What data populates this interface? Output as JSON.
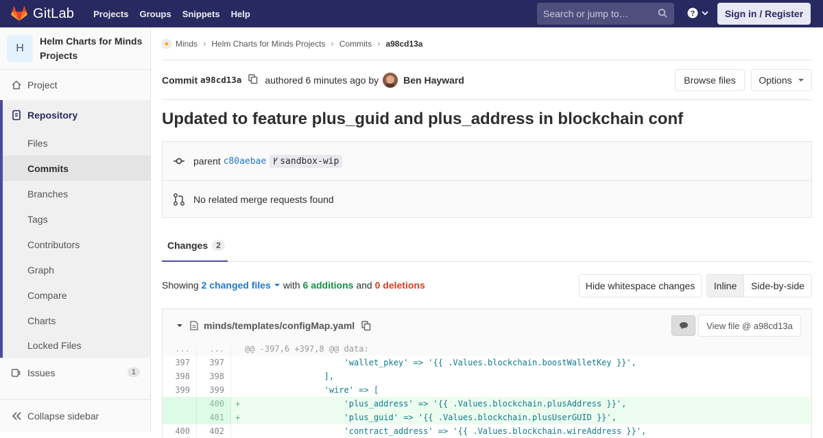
{
  "topbar": {
    "brand": "GitLab",
    "nav": [
      "Projects",
      "Groups",
      "Snippets",
      "Help"
    ],
    "search_placeholder": "Search or jump to…",
    "signin_label": "Sign in / Register",
    "bg_color": "#292961"
  },
  "sidebar": {
    "project_initial": "H",
    "project_name": "Helm Charts for Minds Projects",
    "items": {
      "project": "Project",
      "repository": "Repository",
      "issues": "Issues",
      "issues_count": "1",
      "collapse": "Collapse sidebar"
    },
    "repo_sub": [
      "Files",
      "Commits",
      "Branches",
      "Tags",
      "Contributors",
      "Graph",
      "Compare",
      "Charts",
      "Locked Files"
    ],
    "active_sub": "Commits"
  },
  "breadcrumb": [
    "Minds",
    "Helm Charts for Minds Projects",
    "Commits",
    "a98cd13a"
  ],
  "commit": {
    "label": "Commit",
    "sha": "a98cd13a",
    "authored": "authored 6 minutes ago by",
    "author": "Ben Hayward",
    "browse_label": "Browse files",
    "options_label": "Options",
    "title": "Updated to feature plus_guid and plus_address in blockchain conf",
    "parent_label": "parent",
    "parent_sha": "c80aebae",
    "branch": "sandbox-wip",
    "mr_text": "No related merge requests found"
  },
  "tabs": {
    "changes_label": "Changes",
    "changes_count": "2"
  },
  "summary": {
    "showing": "Showing",
    "changed_files": "2 changed files",
    "with": "with",
    "additions": "6 additions",
    "and": "and",
    "deletions": "0 deletions",
    "hide_ws": "Hide whitespace changes",
    "inline": "Inline",
    "side_by_side": "Side-by-side"
  },
  "file": {
    "path": "minds/templates/configMap.yaml",
    "view_label": "View file @ a98cd13a"
  },
  "diff": {
    "lines": [
      {
        "type": "meta",
        "old": "...",
        "new": "...",
        "mark": "",
        "code": "@@ -397,6 +397,8 @@ data:"
      },
      {
        "type": "ctx",
        "old": "397",
        "new": "397",
        "mark": "",
        "code": "                    'wallet_pkey' => '{{ .Values.blockchain.boostWalletKey }}',"
      },
      {
        "type": "ctx",
        "old": "398",
        "new": "398",
        "mark": "",
        "code": "                ],"
      },
      {
        "type": "ctx",
        "old": "399",
        "new": "399",
        "mark": "",
        "code": "                'wire' => ["
      },
      {
        "type": "add",
        "old": "",
        "new": "400",
        "mark": "+",
        "code": "                    'plus_address' => '{{ .Values.blockchain.plusAddress }}',"
      },
      {
        "type": "add",
        "old": "",
        "new": "401",
        "mark": "+",
        "code": "                    'plus_guid' => '{{ .Values.blockchain.plusUserGUID }}',"
      },
      {
        "type": "ctx",
        "old": "400",
        "new": "402",
        "mark": "",
        "code": "                    'contract_address' => '{{ .Values.blockchain.wireAddress }}',"
      }
    ]
  }
}
